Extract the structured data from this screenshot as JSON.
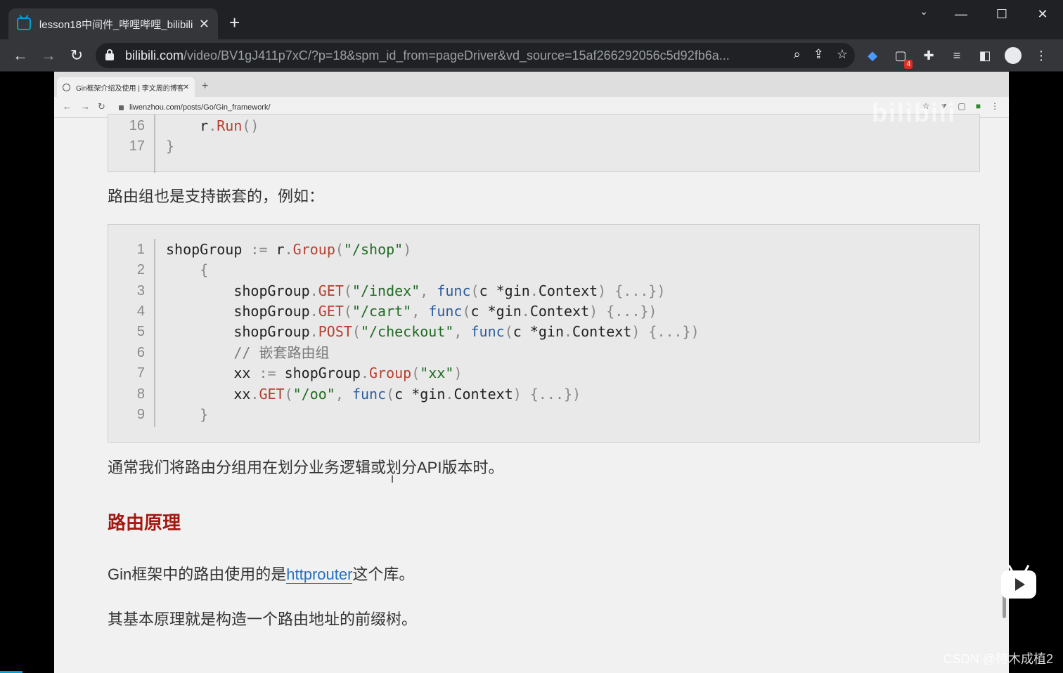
{
  "browser": {
    "tab_title": "lesson18中间件_哔哩哔哩_bilibili",
    "url_host": "bilibili.com",
    "url_path": "/video/BV1gJ411p7xC/?p=18&spm_id_from=pageDriver&vd_source=15af266292056c5d92fb6a...",
    "extension_badge": "4"
  },
  "inner_browser": {
    "tab_title": "Gin框架介绍及使用 | 李文周的博客",
    "url": "liwenzhou.com/posts/Go/Gin_framework/"
  },
  "code_top": [
    {
      "n": "16",
      "html": "    <span>r</span><span class='p'>.</span><span class='m'>Run</span><span class='p'>()</span>"
    },
    {
      "n": "17",
      "html": "<span class='p'>}</span>"
    }
  ],
  "paragraph_nested": "路由组也是支持嵌套的，例如：",
  "code_main": [
    {
      "n": "1",
      "text": "shopGroup := r.Group(\"/shop\")"
    },
    {
      "n": "2",
      "text": "    {"
    },
    {
      "n": "3",
      "text": "        shopGroup.GET(\"/index\", func(c *gin.Context) {...})"
    },
    {
      "n": "4",
      "text": "        shopGroup.GET(\"/cart\", func(c *gin.Context) {...})"
    },
    {
      "n": "5",
      "text": "        shopGroup.POST(\"/checkout\", func(c *gin.Context) {...})"
    },
    {
      "n": "6",
      "text": "        // 嵌套路由组"
    },
    {
      "n": "7",
      "text": "        xx := shopGroup.Group(\"xx\")"
    },
    {
      "n": "8",
      "text": "        xx.GET(\"/oo\", func(c *gin.Context) {...})"
    },
    {
      "n": "9",
      "text": "    }"
    }
  ],
  "paragraph_usage": "通常我们将路由分组用在划分业务逻辑或划分API版本时。",
  "heading_routing": "路由原理",
  "paragraph_gin_prefix": "Gin框架中的路由使用的是",
  "link_httprouter": "httprouter",
  "paragraph_gin_suffix": "这个库。",
  "paragraph_tree": "其基本原理就是构造一个路由地址的前缀树。",
  "watermark": "CSDN @待木成植2",
  "bili_logo": "bilibili"
}
